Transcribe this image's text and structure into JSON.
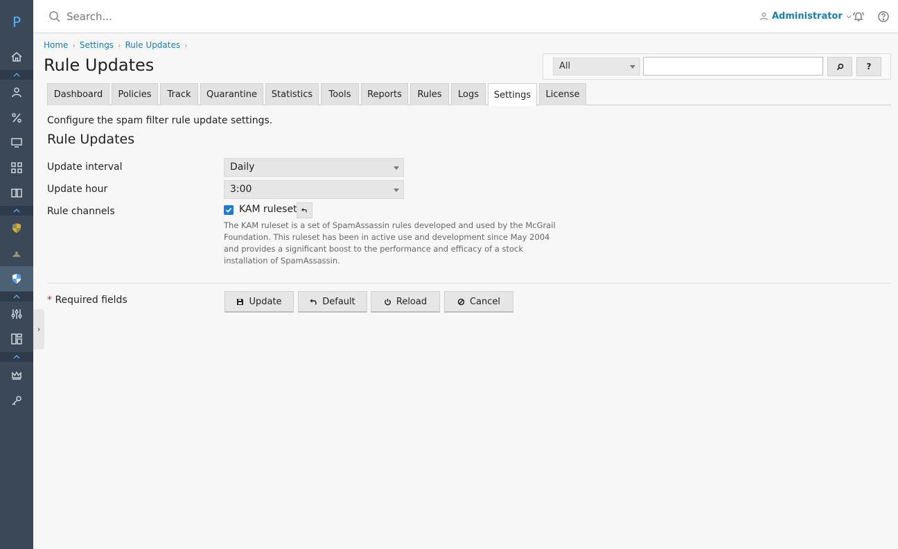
{
  "app": {
    "logo_letter": "P"
  },
  "topbar": {
    "search_placeholder": "Search...",
    "user_name": "Administrator"
  },
  "breadcrumb": [
    "Home",
    "Settings",
    "Rule Updates"
  ],
  "page_title": "Rule Updates",
  "quick_search": {
    "scope": "All",
    "search_btn": "⌕",
    "help_btn": "?"
  },
  "tabs": [
    {
      "label": "Dashboard",
      "active": false
    },
    {
      "label": "Policies",
      "active": false
    },
    {
      "label": "Track",
      "active": false
    },
    {
      "label": "Quarantine",
      "active": false
    },
    {
      "label": "Statistics",
      "active": false
    },
    {
      "label": "Tools",
      "active": false
    },
    {
      "label": "Reports",
      "active": false
    },
    {
      "label": "Rules",
      "active": false
    },
    {
      "label": "Logs",
      "active": false
    },
    {
      "label": "Settings",
      "active": true
    },
    {
      "label": "License",
      "active": false
    }
  ],
  "form": {
    "description": "Configure the spam filter rule update settings.",
    "section_title": "Rule Updates",
    "update_interval_label": "Update interval",
    "update_interval_value": "Daily",
    "update_hour_label": "Update hour",
    "update_hour_value": "3:00",
    "rule_channels_label": "Rule channels",
    "kam_label": "KAM ruleset",
    "kam_checked": true,
    "kam_help": "The KAM ruleset is a set of SpamAssassin rules developed and used by the McGrail Foundation. This ruleset has been in active use and development since May 2004 and provides a significant boost to the performance and efficacy of a stock installation of SpamAssassin.",
    "required_star": "*",
    "required_label": "Required fields"
  },
  "buttons": {
    "update": "Update",
    "default": "Default",
    "reload": "Reload",
    "cancel": "Cancel"
  },
  "colors": {
    "sidebar": "#3b4858",
    "accent": "#1c7cb6",
    "checkbox": "#1c7cd6"
  }
}
